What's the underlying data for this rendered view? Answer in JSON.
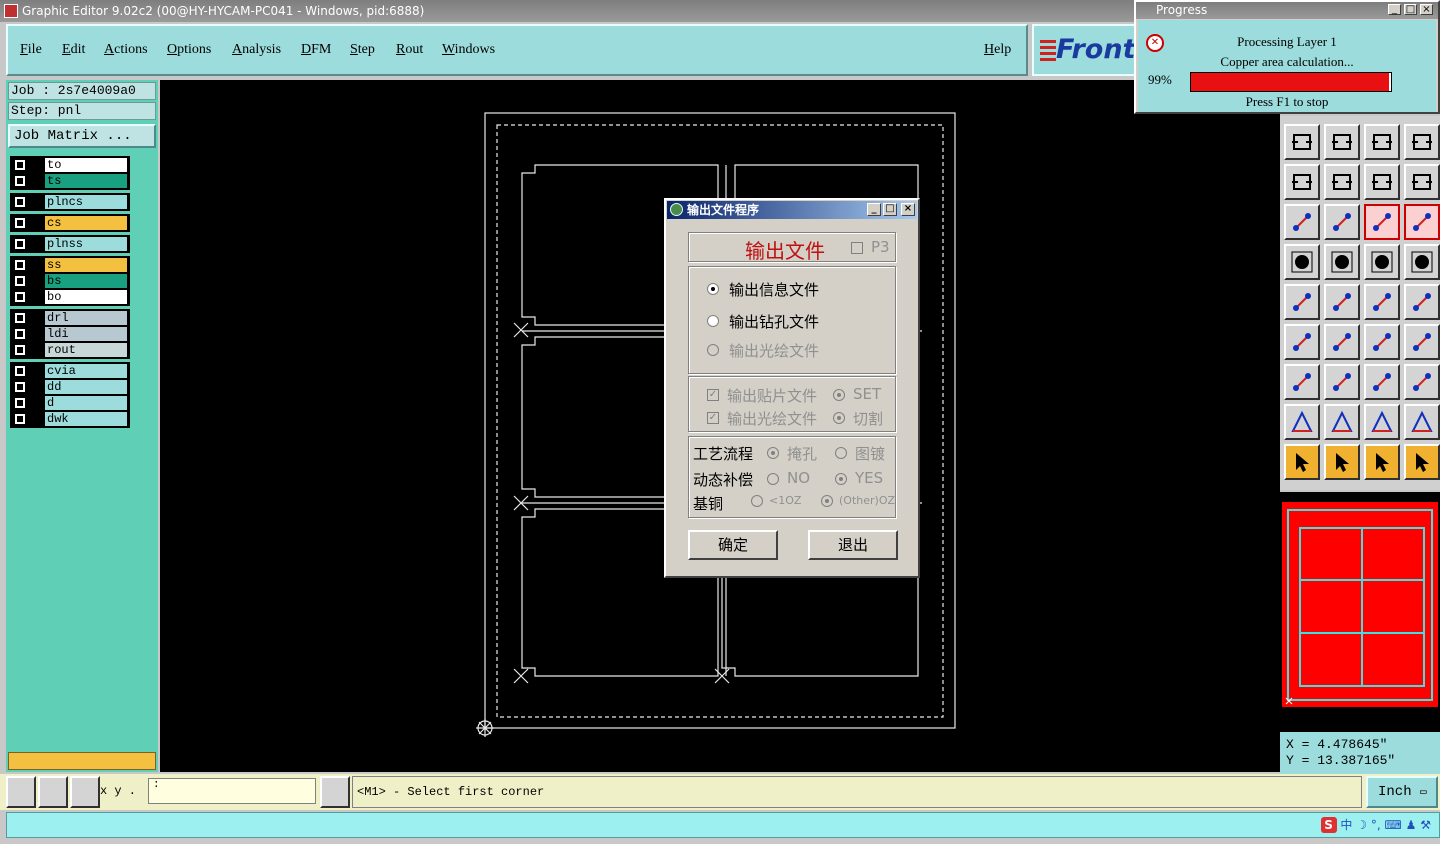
{
  "window": {
    "title": "Graphic Editor 9.02c2 (00@HY-HYCAM-PC041 - Windows, pid:6888)"
  },
  "menu": {
    "items": [
      "File",
      "Edit",
      "Actions",
      "Options",
      "Analysis",
      "DFM",
      "Step",
      "Rout",
      "Windows"
    ],
    "help": "Help"
  },
  "logo": {
    "text": "Front"
  },
  "job": {
    "job_label": "Job : 2s7e4009a0",
    "step_label": "Step: pnl",
    "matrix_button": "Job Matrix ..."
  },
  "layers": [
    {
      "name": "to",
      "color": "#ffffff"
    },
    {
      "name": "ts",
      "color": "#18a080"
    },
    {
      "name": "plncs",
      "color": "#9cdcdc"
    },
    {
      "name": "cs",
      "color": "#f4c040"
    },
    {
      "name": "plnss",
      "color": "#9cdcdc"
    },
    {
      "name": "ss",
      "color": "#f4c040"
    },
    {
      "name": "bs",
      "color": "#18a080"
    },
    {
      "name": "bo",
      "color": "#ffffff"
    },
    {
      "name": "drl",
      "color": "#b8c8d0"
    },
    {
      "name": "ldi",
      "color": "#b8c8d0"
    },
    {
      "name": "rout",
      "color": "#c8d8d8"
    },
    {
      "name": "cvia",
      "color": "#9cdcdc"
    },
    {
      "name": "dd",
      "color": "#9cdcdc"
    },
    {
      "name": "d",
      "color": "#9cdcdc"
    },
    {
      "name": "dwk",
      "color": "#9cdcdc"
    }
  ],
  "dialog": {
    "title": "输出文件程序",
    "heading": "输出文件",
    "p3_label": "P3",
    "radio_options": [
      {
        "label": "输出信息文件",
        "selected": true,
        "enabled": true
      },
      {
        "label": "输出钻孔文件",
        "selected": false,
        "enabled": true
      },
      {
        "label": "输出光绘文件",
        "selected": false,
        "enabled": false
      }
    ],
    "check_rows": [
      {
        "label": "输出贴片文件",
        "option": "SET"
      },
      {
        "label": "输出光绘文件",
        "option": "切割"
      }
    ],
    "process_label": "工艺流程",
    "process_opts": [
      "掩孔",
      "图镀"
    ],
    "comp_label": "动态补偿",
    "comp_opts": [
      "NO",
      "YES"
    ],
    "copper_label": "基铜",
    "copper_opts": [
      "<1OZ",
      "(Other)OZ"
    ],
    "ok": "确定",
    "exit": "退出"
  },
  "progress": {
    "title": "Progress",
    "line1": "Processing Layer 1",
    "line2": "Copper area calculation...",
    "percent_text": "99%",
    "percent": 0.99,
    "stop_hint": "Press F1 to stop"
  },
  "coords": {
    "x": "X = 4.478645\"",
    "y": "Y = 13.387165\""
  },
  "status": {
    "xyz": "x y .",
    "input_value": ":",
    "prompt": "<M1> - Select first corner",
    "units": "Inch"
  },
  "ime": {
    "label": "中"
  },
  "colors": {
    "panel": "#5fcfb6",
    "menu": "#9cdcdc",
    "accent_red": "#e81010"
  }
}
